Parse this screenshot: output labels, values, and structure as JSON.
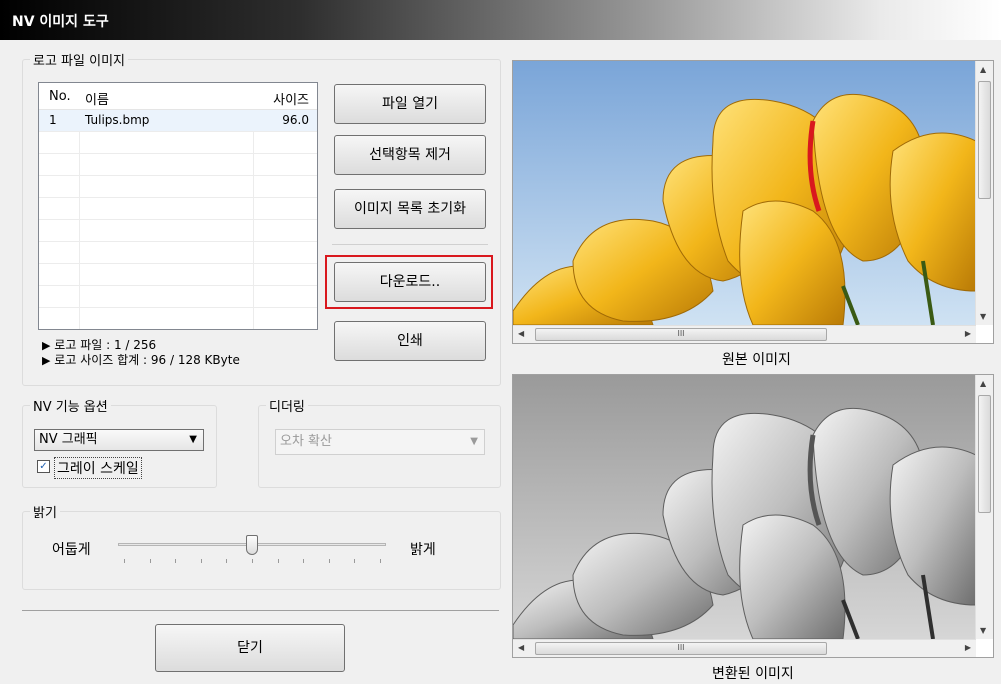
{
  "window": {
    "title": "NV 이미지 도구"
  },
  "logo_group": {
    "legend": "로고 파일 이미지",
    "columns": [
      "No.",
      "이름",
      "사이즈"
    ],
    "rows": [
      {
        "no": "1",
        "name": "Tulips.bmp",
        "size": "96.0"
      }
    ],
    "status_file": "로고 파일 : 1 / 256",
    "status_size": "로고 사이즈 합계 : 96 / 128 KByte"
  },
  "buttons": {
    "open": "파일 열기",
    "remove": "선택항목 제거",
    "reset": "이미지 목록 초기화",
    "download": "다운로드..",
    "print": "인쇄",
    "close": "닫기"
  },
  "nv_options": {
    "legend": "NV 기능 옵션",
    "mode": "NV 그래픽",
    "grayscale_label": "그레이 스케일",
    "grayscale_checked": true
  },
  "dithering": {
    "legend": "디더링",
    "value": "오차 확산",
    "enabled": false
  },
  "brightness": {
    "legend": "밝기",
    "dark_label": "어둡게",
    "bright_label": "밝게",
    "level": 0.5
  },
  "preview": {
    "original_caption": "원본 이미지",
    "converted_caption": "변환된 이미지",
    "scroll_grip": "III"
  },
  "colors": {
    "highlight": "#d9181e"
  }
}
